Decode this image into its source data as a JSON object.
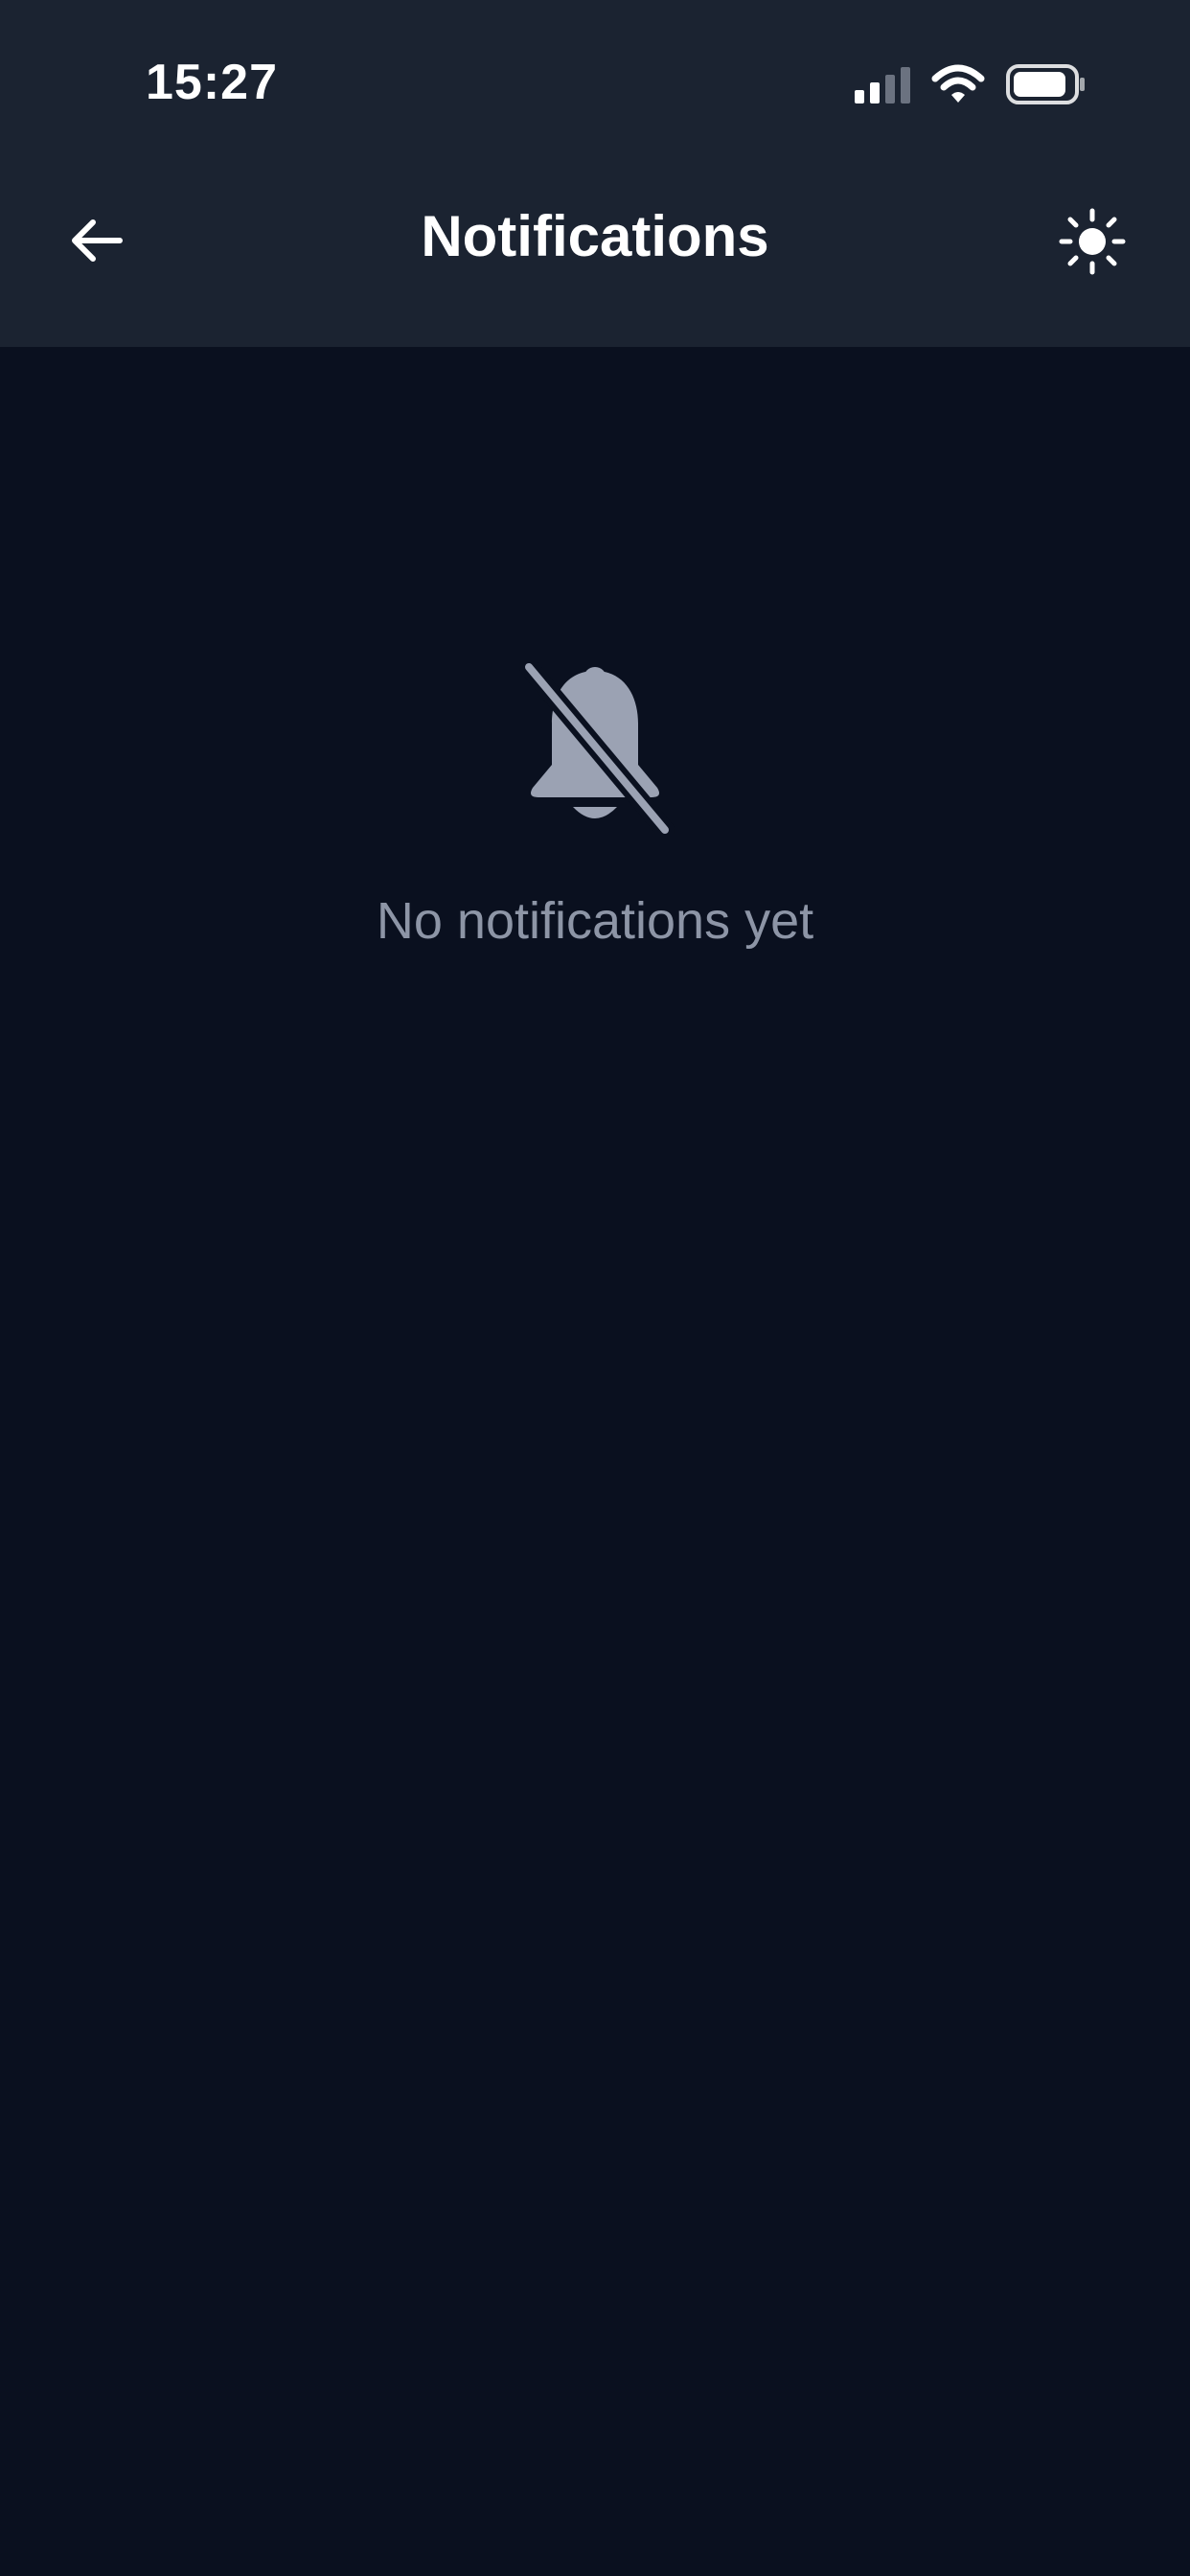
{
  "status_bar": {
    "time": "15:27",
    "icons": [
      "signal-icon",
      "wifi-icon",
      "battery-icon"
    ]
  },
  "header": {
    "title": "Notifications",
    "back_icon": "arrow-left-icon",
    "theme_icon": "sun-icon"
  },
  "empty_state": {
    "icon": "bell-off-icon",
    "message": "No notifications yet"
  },
  "colors": {
    "header_background": "#1b2331",
    "page_background": "#0a101f",
    "muted_text": "#8d95a6",
    "icon_gray": "#9ba2b3"
  }
}
